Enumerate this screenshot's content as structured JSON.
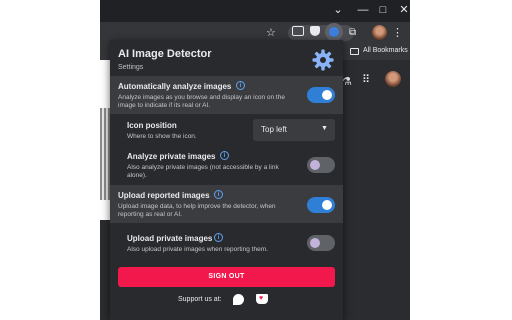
{
  "browser": {
    "window_controls": {
      "minimize": "—",
      "maximize": "□",
      "close": "✕"
    },
    "bookmarks_label": "All Bookmarks"
  },
  "popup": {
    "title": "AI Image Detector",
    "subtitle": "Settings",
    "settings": {
      "auto_analyze": {
        "label": "Automatically analyze images",
        "description": "Analyze images as you browse and display an icon on the image to indicate if its real or AI.",
        "enabled": true
      },
      "icon_position": {
        "label": "Icon position",
        "description": "Where to show the icon.",
        "selected": "Top left"
      },
      "analyze_private": {
        "label": "Analyze private images",
        "description": "Also analyze private images (not accessible by a link alone).",
        "enabled": false
      },
      "upload_reported": {
        "label": "Upload reported images",
        "description": "Upload image data, to help improve the detector, when reporting as real or AI.",
        "enabled": true
      },
      "upload_private": {
        "label": "Upload private images",
        "description": "Also upload private images when reporting them.",
        "enabled": false
      }
    },
    "sign_out_label": "SIGN OUT",
    "support_label": "Support us at:"
  },
  "colors": {
    "accent": "#2f7fd6",
    "sign_out": "#f2184c",
    "panel": "#292a2d",
    "panel_light": "#3b3c40"
  }
}
